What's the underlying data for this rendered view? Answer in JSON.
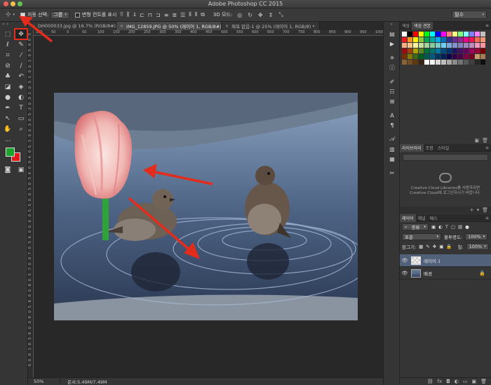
{
  "app": {
    "title": "Adobe Photoshop CC 2015",
    "traffic_lights": [
      "#ed5f57",
      "#f5bf4f",
      "#5fc454"
    ]
  },
  "options_bar": {
    "tool_icon": "move-tool-icon",
    "auto_select_label": "자동 선택:",
    "auto_select_value": "그룹",
    "transform_controls_label": "변형 컨트롤 표시",
    "mode_3d_label": "3D 모드:",
    "workspace_value": "필수"
  },
  "tabs": [
    {
      "label": "DH000033.jpg @ 16.7% (RGB/8#)",
      "close": "×"
    },
    {
      "label": "IMG_12859.JPG @ 50% (레이어 1, RGB/8#) *",
      "close": "×"
    },
    {
      "label": "제목 없음-1 @ 25% (레이어 1, RGB/8) *",
      "close": "×"
    }
  ],
  "ruler": {
    "top": [
      "100",
      "50",
      "0",
      "50",
      "100",
      "150",
      "200",
      "250",
      "300",
      "350",
      "400",
      "450",
      "500",
      "550",
      "600",
      "650",
      "700",
      "750",
      "800",
      "850",
      "900",
      "950",
      "1000"
    ],
    "left": [
      "5",
      "0",
      "0",
      "5",
      "0",
      "1",
      "0",
      "0",
      "1",
      "5",
      "0",
      "2",
      "0",
      "0",
      "2",
      "5",
      "0",
      "3",
      "0",
      "0",
      "3",
      "5",
      "0",
      "4",
      "0",
      "0",
      "4",
      "5",
      "0",
      "5",
      "0",
      "0",
      "5",
      "5",
      "0",
      "6",
      "0",
      "0",
      "6",
      "5",
      "0",
      "7",
      "0",
      "0",
      "7",
      "5",
      "0",
      "8",
      "0",
      "0",
      "8",
      "5",
      "0",
      "9",
      "0",
      "0",
      "9",
      "5",
      "0",
      "1",
      "0",
      "0",
      "0"
    ]
  },
  "status": {
    "zoom": "50%",
    "doc_size": "문서:5.49M/7.49M"
  },
  "colors": {
    "foreground": "#19a32b",
    "background": "#e3161b",
    "annotation_arrow": "#e42c1c"
  },
  "swatches_panel": {
    "tabs": [
      "색상",
      "색상 견본"
    ],
    "swatches": [
      "#ffffff",
      "#000000",
      "#ff0000",
      "#ffff00",
      "#00ff00",
      "#00ffff",
      "#0000ff",
      "#ff00ff",
      "#ff8080",
      "#ffff80",
      "#80ff80",
      "#80ffff",
      "#8080ff",
      "#ff80ff",
      "#c0c0c0",
      "#ed1c24",
      "#f7941d",
      "#fff200",
      "#8dc63f",
      "#00a651",
      "#00a99d",
      "#00aeef",
      "#0072bc",
      "#2e3192",
      "#662d91",
      "#92278f",
      "#ec008c",
      "#ed145b",
      "#f26c4f",
      "#f69679",
      "#f9ad81",
      "#fdc689",
      "#fff799",
      "#c4df9b",
      "#a3d39c",
      "#82ca9c",
      "#7accc8",
      "#6dcff6",
      "#7da7d9",
      "#8393ca",
      "#8781bd",
      "#a186be",
      "#bd8cbf",
      "#f49ac1",
      "#f5989d",
      "#9e0b0f",
      "#a0410d",
      "#aba000",
      "#598527",
      "#007236",
      "#00746b",
      "#0076a3",
      "#004a80",
      "#003471",
      "#1b1464",
      "#440e62",
      "#630460",
      "#9e005d",
      "#9e0039",
      "#790000",
      "#7b2e00",
      "#827b00",
      "#406618",
      "#005e20",
      "#005952",
      "#005b7f",
      "#003663",
      "#002157",
      "#0d004c",
      "#32004b",
      "#4b0049",
      "#7b0046",
      "#7a0026",
      "#c69c6d",
      "#a67c52",
      "#8c6239",
      "#754c24",
      "#603913",
      "#3c2415",
      "#ffffff",
      "#f2f2f2",
      "#d9d9d9",
      "#bfbfbf",
      "#a6a6a6",
      "#8c8c8c",
      "#737373",
      "#595959",
      "#404040",
      "#262626",
      "#0d0d0d"
    ]
  },
  "libraries_panel": {
    "tabs": [
      "라이브러리",
      "조정",
      "스타일"
    ],
    "message_line1": "Creative Cloud Libraries를 사용하려면",
    "message_line2": "Creative Cloud에 로그인하시기 바랍니다."
  },
  "layers_panel": {
    "tabs": [
      "레이어",
      "채널",
      "패스"
    ],
    "filter_label": "종류",
    "blend_mode": "표준",
    "opacity_label": "불투명도:",
    "opacity_value": "100%",
    "lock_label": "잠그기:",
    "fill_label": "칠:",
    "fill_value": "100%",
    "layers": [
      {
        "name": "레이어 1",
        "active": true
      },
      {
        "name": "배경",
        "active": false
      }
    ]
  }
}
